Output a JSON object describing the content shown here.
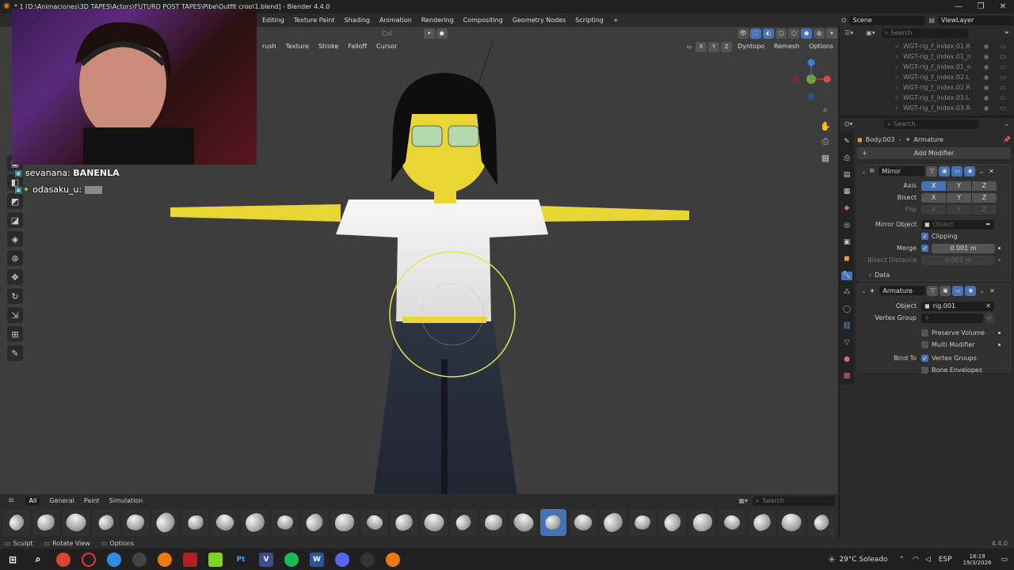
{
  "titlebar": {
    "title": "* 1 [D:\\Animaciones\\3D TAPES\\Actors\\FUTURO POST TAPES\\Pibe\\Outfit crop\\1.blend] - Blender 4.4.0"
  },
  "workspaces": [
    "Editing",
    "Texture Paint",
    "Shading",
    "Animation",
    "Rendering",
    "Compositing",
    "Geometry Nodes",
    "Scripting"
  ],
  "scene": {
    "label": "Scene",
    "view_layer": "ViewLayer"
  },
  "viewport_header": {
    "menus": [
      "rush",
      "Texture",
      "Stroke",
      "Falloff",
      "Cursor"
    ],
    "col_label": "Col",
    "axes": [
      "X",
      "Y",
      "Z"
    ],
    "dyntopo": "Dyntopo",
    "remesh": "Remesh",
    "options": "Options"
  },
  "chat": [
    {
      "user": "sevanana",
      "message": "BANENLA"
    },
    {
      "user": "odasaku_u",
      "message": ""
    }
  ],
  "outliner": {
    "search_placeholder": "Search",
    "items": [
      "WGT-rig_f_index.01.R",
      "WGT-rig_f_index.01_n",
      "WGT-rig_f_index.01_n",
      "WGT-rig_f_index.02.L",
      "WGT-rig_f_index.02.R",
      "WGT-rig_f_index.03.L",
      "WGT-rig_f_index.03.R"
    ]
  },
  "properties": {
    "search_placeholder": "Search",
    "breadcrumb_object": "Body.003",
    "breadcrumb_modifier": "Armature",
    "add_modifier": "Add Modifier",
    "mirror": {
      "name": "Mirror",
      "axis_label": "Axis",
      "bisect_label": "Bisect",
      "flip_label": "Flip",
      "axes": [
        "X",
        "Y",
        "Z"
      ],
      "mirror_object_label": "Mirror Object",
      "mirror_object_placeholder": "Object",
      "clipping_label": "Clipping",
      "merge_label": "Merge",
      "merge_value": "0.001 m",
      "bisect_distance_label": "Bisect Distance",
      "bisect_distance_value": "0.001 m",
      "data_label": "Data"
    },
    "armature": {
      "name": "Armature",
      "object_label": "Object",
      "object_value": "rig.001",
      "vertex_group_label": "Vertex Group",
      "preserve_volume": "Preserve Volume",
      "multi_modifier": "Multi Modifier",
      "bind_to_label": "Bind To",
      "vertex_groups": "Vertex Groups",
      "bone_envelopes": "Bone Envelopes"
    }
  },
  "sculpt_shelf": {
    "tabs": [
      "All",
      "General",
      "Paint",
      "Simulation"
    ],
    "search_placeholder": "Search",
    "brush_count": 28,
    "active_index": 18
  },
  "statusbar": {
    "sculpt": "Sculpt",
    "rotate": "Rotate View",
    "options": "Options",
    "version": "4.4.0"
  },
  "taskbar": {
    "weather": "29°C Soleado",
    "lang": "ESP",
    "time": "18:19",
    "date": "19/3/2026"
  },
  "colors": {
    "accent": "#4772b3",
    "viewport": "#3d3d3d",
    "brush_circle": "#e6e64d"
  }
}
